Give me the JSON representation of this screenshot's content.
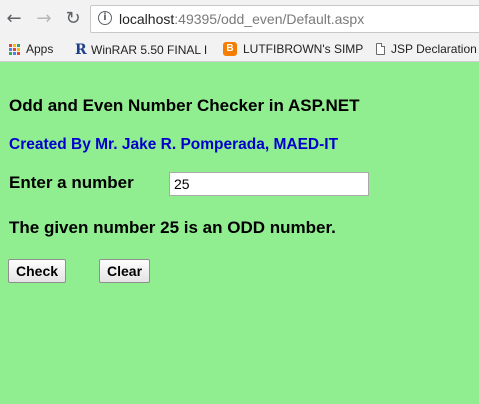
{
  "browser": {
    "url_host": "localhost",
    "url_rest": ":49395/odd_even/Default.aspx",
    "bookmarks": [
      {
        "label": "Apps",
        "icon": "apps-grid-icon"
      },
      {
        "label": "WinRAR 5.50 FINAL I",
        "icon": "r-logo-icon"
      },
      {
        "label": "LUTFIBROWN's SIMP",
        "icon": "blogger-icon"
      },
      {
        "label": "JSP Declaration",
        "icon": "page-icon"
      }
    ]
  },
  "page": {
    "title": "Odd and Even Number Checker in ASP.NET",
    "author": "Created By Mr. Jake R. Pomperada, MAED-IT",
    "prompt_label": "Enter a number",
    "number_value": "25",
    "result_text": "The given number 25 is an ODD number.",
    "check_button": "Check",
    "clear_button": "Clear"
  },
  "colors": {
    "page_background": "#90ee90",
    "author_text": "#0000cd"
  }
}
